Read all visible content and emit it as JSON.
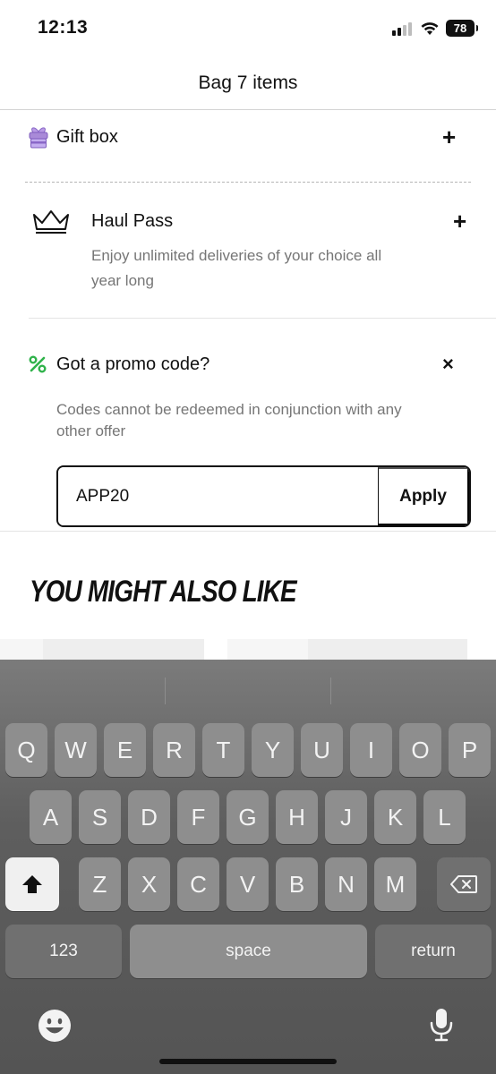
{
  "status": {
    "time": "12:13",
    "battery": "78"
  },
  "header": {
    "title": "Bag 7 items"
  },
  "gift_box": {
    "label": "Gift box",
    "action": "+"
  },
  "haul_pass": {
    "title": "Haul Pass",
    "action": "+",
    "description": "Enjoy unlimited deliveries of your choice all year long"
  },
  "promo": {
    "title": "Got a promo code?",
    "close": "×",
    "description": "Codes cannot be redeemed in conjunction with any other offer",
    "value": "APP20",
    "apply_label": "Apply"
  },
  "recommendations": {
    "title": "YOU MIGHT ALSO LIKE"
  },
  "keyboard": {
    "row1": [
      "Q",
      "W",
      "E",
      "R",
      "T",
      "Y",
      "U",
      "I",
      "O",
      "P"
    ],
    "row2": [
      "A",
      "S",
      "D",
      "F",
      "G",
      "H",
      "J",
      "K",
      "L"
    ],
    "row3": [
      "Z",
      "X",
      "C",
      "V",
      "B",
      "N",
      "M"
    ],
    "numbers_label": "123",
    "space_label": "space",
    "return_label": "return"
  },
  "icons": {
    "gift": "gift-icon",
    "crown": "crown-icon",
    "percent": "percent-icon",
    "shift": "shift-icon",
    "backspace": "backspace-icon",
    "emoji": "emoji-icon",
    "mic": "microphone-icon"
  },
  "colors": {
    "accent_green": "#2fb24a",
    "gift_purple": "#a98ad8"
  }
}
